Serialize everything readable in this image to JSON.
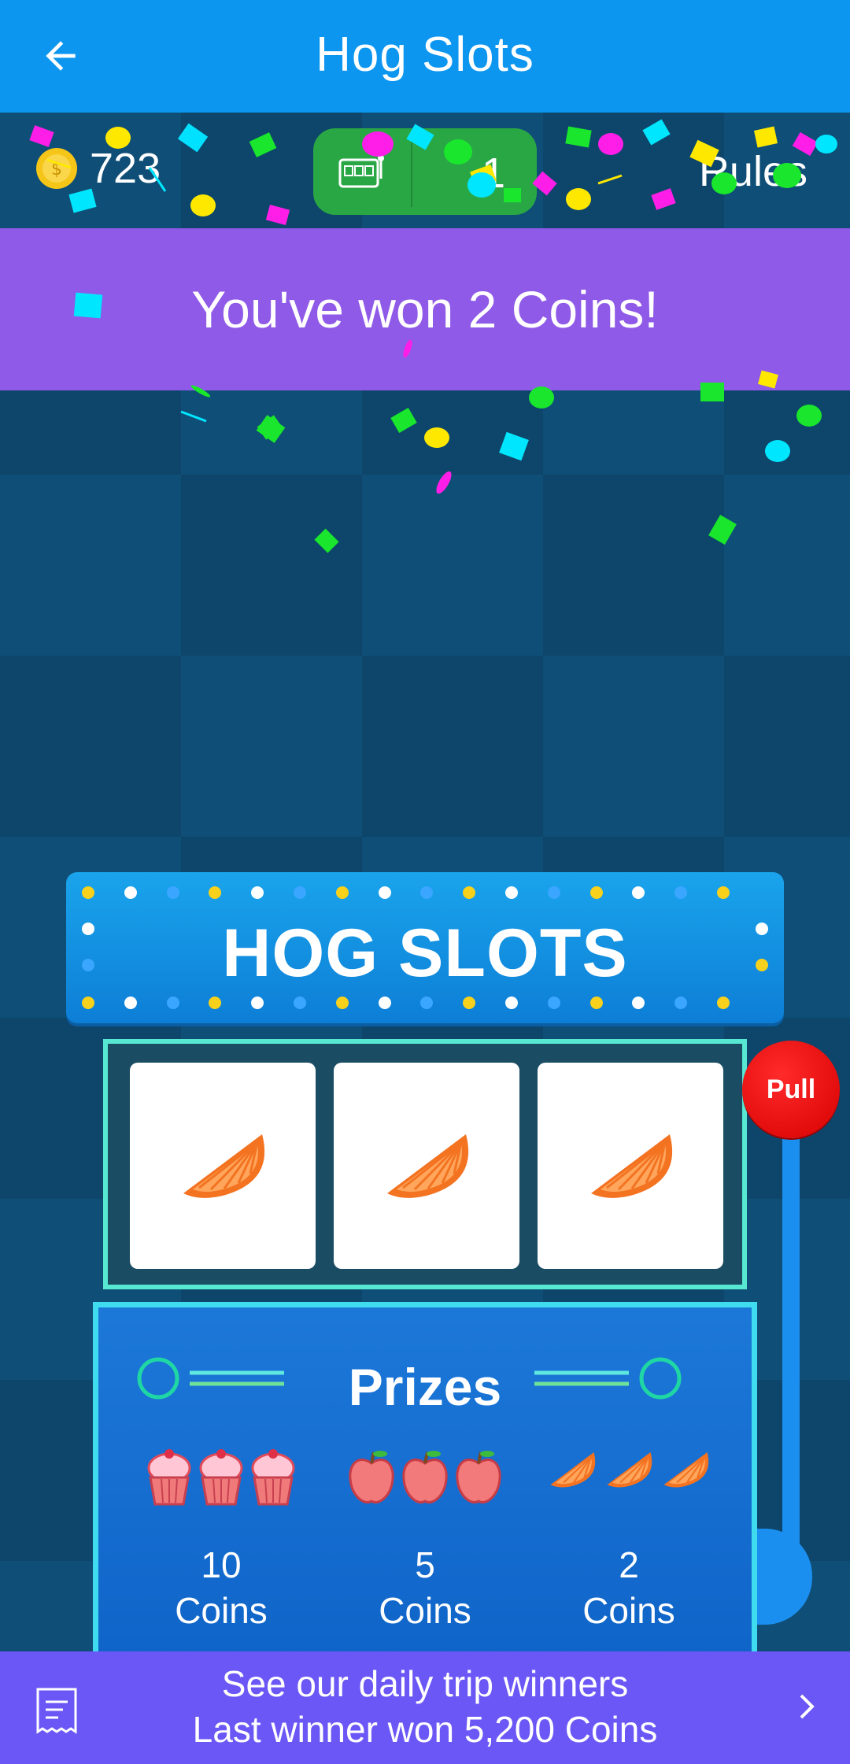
{
  "app_bar": {
    "title": "Hog Slots",
    "back_icon": "arrow-left-icon"
  },
  "stats": {
    "coins": "723",
    "tickets": "1",
    "rules_label": "Rules"
  },
  "win_banner": {
    "message": "You've won 2 Coins!"
  },
  "machine": {
    "title": "HOG SLOTS",
    "reels": [
      "orange-slice-icon",
      "orange-slice-icon",
      "orange-slice-icon"
    ],
    "pull_label": "Pull"
  },
  "prizes": {
    "title": "Prizes",
    "items": [
      {
        "icon": "cupcake-icon",
        "amount": "10",
        "unit": "Coins"
      },
      {
        "icon": "apple-icon",
        "amount": "5",
        "unit": "Coins"
      },
      {
        "icon": "orange-slice-icon",
        "amount": "2",
        "unit": "Coins"
      }
    ]
  },
  "footer": {
    "line1": "See our daily trip winners",
    "line2": "Last winner won 5,200 Coins"
  },
  "colors": {
    "app_bar": "#0d96f0",
    "banner": "#8f5ae8",
    "footer": "#6a57f5",
    "pull": "#e00000"
  }
}
